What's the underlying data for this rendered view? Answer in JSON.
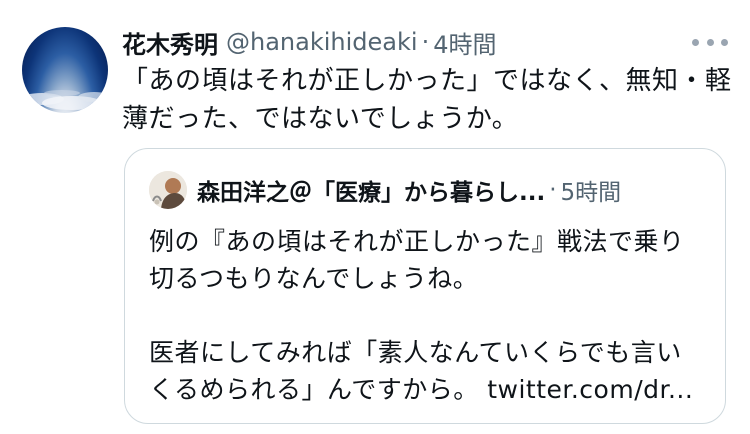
{
  "tweet": {
    "display_name": "花木秀明",
    "handle": "@hanakihideaki",
    "separator": "·",
    "time": "4時間",
    "text_lines": [
      "「あの頃はそれが正しかった」ではなく、無知・軽",
      "薄だった、ではないでしょうか。"
    ],
    "more_icon": "more-horizontal-icon"
  },
  "quote": {
    "display_name": "森田洋之＠「医療」から暮らし...",
    "separator": "·",
    "time": "5時間",
    "text_lines": [
      "例の『あの頃はそれが正しかった』戦法で乗り",
      "切るつもりなんでしょうね。",
      "",
      "医者にしてみれば「素人なんていくらでも言い",
      "くるめられる」んですから。 twitter.com/dr..."
    ]
  },
  "colors": {
    "text_primary": "#0f1419",
    "text_secondary": "#536471",
    "border": "#cfd9de"
  }
}
